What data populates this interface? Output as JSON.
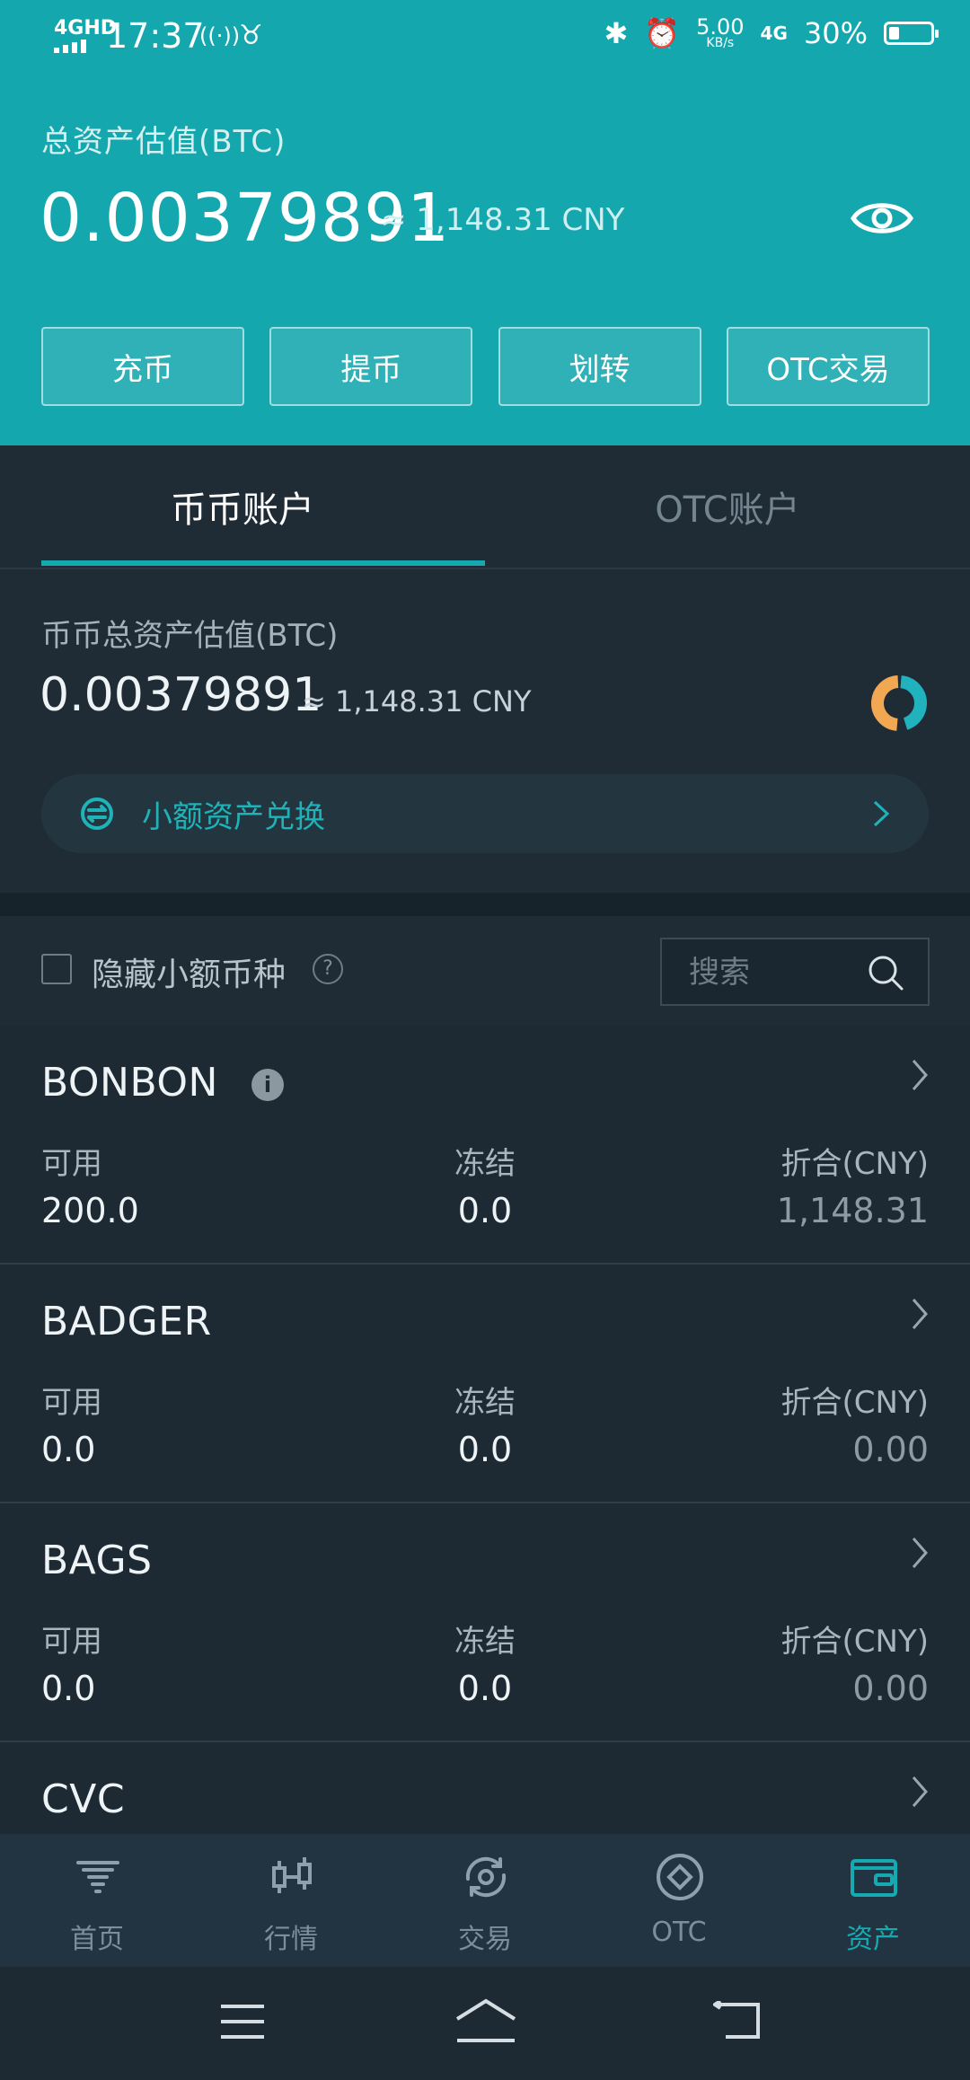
{
  "status_bar": {
    "network": "4GHD",
    "time": "17:37",
    "speed": "5.00",
    "speed_unit": "KB/s",
    "network2": "4G",
    "battery": "30%"
  },
  "header": {
    "title": "总资产估值(BTC)",
    "value": "0.00379891",
    "cny": "≈ 1,148.31 CNY",
    "buttons": [
      "充币",
      "提币",
      "划转",
      "OTC交易"
    ]
  },
  "tabs": {
    "active": "币币账户",
    "inactive": "OTC账户"
  },
  "summary": {
    "title": "币币总资产估值(BTC)",
    "value": "0.00379891",
    "cny": "≈ 1,148.31 CNY",
    "small_exchange": "小额资产兑换"
  },
  "filter": {
    "hide_label": "隐藏小额币种",
    "help": "?",
    "search_placeholder": "搜索"
  },
  "columns": {
    "available": "可用",
    "frozen": "冻结",
    "equiv": "折合(CNY)"
  },
  "assets": [
    {
      "name": "BONBON",
      "available": "200.0",
      "frozen": "0.0",
      "equiv": "1,148.31"
    },
    {
      "name": "BADGER",
      "available": "0.0",
      "frozen": "0.0",
      "equiv": "0.00"
    },
    {
      "name": "BAGS",
      "available": "0.0",
      "frozen": "0.0",
      "equiv": "0.00"
    },
    {
      "name": "CVC",
      "available": "",
      "frozen": "",
      "equiv": ""
    }
  ],
  "nav": {
    "items": [
      {
        "label": "首页",
        "icon": "home-icon"
      },
      {
        "label": "行情",
        "icon": "candlestick-icon"
      },
      {
        "label": "交易",
        "icon": "trade-icon"
      },
      {
        "label": "OTC",
        "icon": "otc-icon"
      },
      {
        "label": "资产",
        "icon": "wallet-icon"
      }
    ],
    "active_index": 4
  },
  "colors": {
    "brand_teal": "#14a7ae",
    "background": "#1d2a34",
    "accent": "#15aab2"
  }
}
